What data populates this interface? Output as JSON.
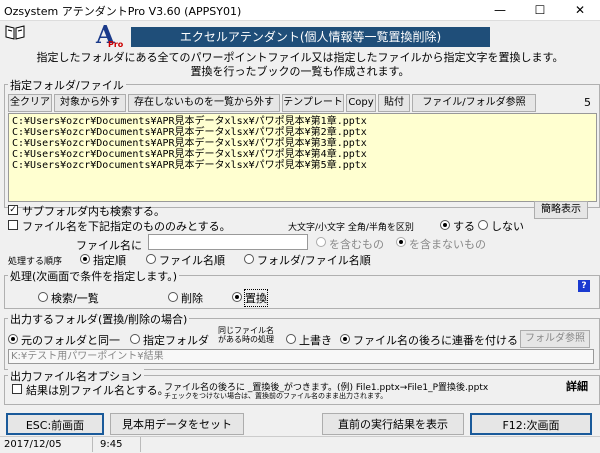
{
  "window": {
    "title": "Ozsystem アテンダントPro V3.60 (APPSY01)",
    "minimize": "—",
    "maximize": "☐",
    "close": "✕"
  },
  "logo": {
    "letter": "A",
    "sub": "Pro"
  },
  "banner": "エクセルアテンダント(個人情報等一覧置換削除)",
  "description": [
    "指定したフォルダにある全てのパワーポイントファイル又は指定したファイルから指定文字を置換します。",
    "置換を行ったブックの一覧も作成されます。"
  ],
  "folder_group": {
    "legend": "指定フォルダ/ファイル",
    "buttons": [
      "全クリア",
      "対象から外す",
      "存在しないものを一覧から外す",
      "テンプレート",
      "Copy",
      "貼付",
      "ファイル/フォルダ参照"
    ],
    "count": "5",
    "files": [
      "C:¥Users¥ozcr¥Documents¥APR見本データxlsx¥パワポ見本¥第1章.pptx",
      "C:¥Users¥ozcr¥Documents¥APR見本データxlsx¥パワポ見本¥第2章.pptx",
      "C:¥Users¥ozcr¥Documents¥APR見本データxlsx¥パワポ見本¥第3章.pptx",
      "C:¥Users¥ozcr¥Documents¥APR見本データxlsx¥パワポ見本¥第4章.pptx",
      "C:¥Users¥ozcr¥Documents¥APR見本データxlsx¥パワポ見本¥第5章.pptx"
    ]
  },
  "options": {
    "subfolder": "サブフォルダ内も検索する。",
    "filename_only": "ファイル名を下記指定のもののみとする。",
    "detail_button": "簡略表示",
    "case_label": "大文字/小文字 全角/半角を区別",
    "case_yes": "する",
    "case_no": "しない",
    "filename_label": "ファイル名に",
    "filename_value": "",
    "include": "を含むもの",
    "exclude": "を含まないもの",
    "order_label": "処理する順序",
    "order_options": [
      "指定順",
      "ファイル名順",
      "フォルダ/ファイル名順"
    ]
  },
  "process_group": {
    "legend": "処理(次画面で条件を指定します。)",
    "options": [
      "検索/一覧",
      "削除",
      "置換"
    ],
    "help": "?"
  },
  "output_group": {
    "legend": "出力するフォルダ(置換/削除の場合)",
    "same": "元のフォルダと同一",
    "specified": "指定フォルダ",
    "same_name_label": [
      "同じファイル名",
      "がある時の処理"
    ],
    "overwrite": "上書き",
    "append": "ファイル名の後ろに連番を付ける",
    "browse": "フォルダ参照",
    "path": "K:¥テスト用パワーポイント¥結果"
  },
  "filename_group": {
    "legend": "出力ファイル名オプション",
    "separate": "結果は別ファイル名とする。",
    "note1": "ファイル名の後ろに _置換後_がつきます。(例) File1.pptx→File1_P置換後.pptx",
    "note2": "チェックをつけない場合は、置換前のファイル名のまま出力されます。",
    "detail": "詳細"
  },
  "footer_buttons": {
    "esc": "ESC:前画面",
    "sample": "見本用データをセット",
    "last_result": "直前の実行結果を表示",
    "f12": "F12:次画面"
  },
  "status": {
    "date": "2017/12/05",
    "time": "9:45"
  }
}
